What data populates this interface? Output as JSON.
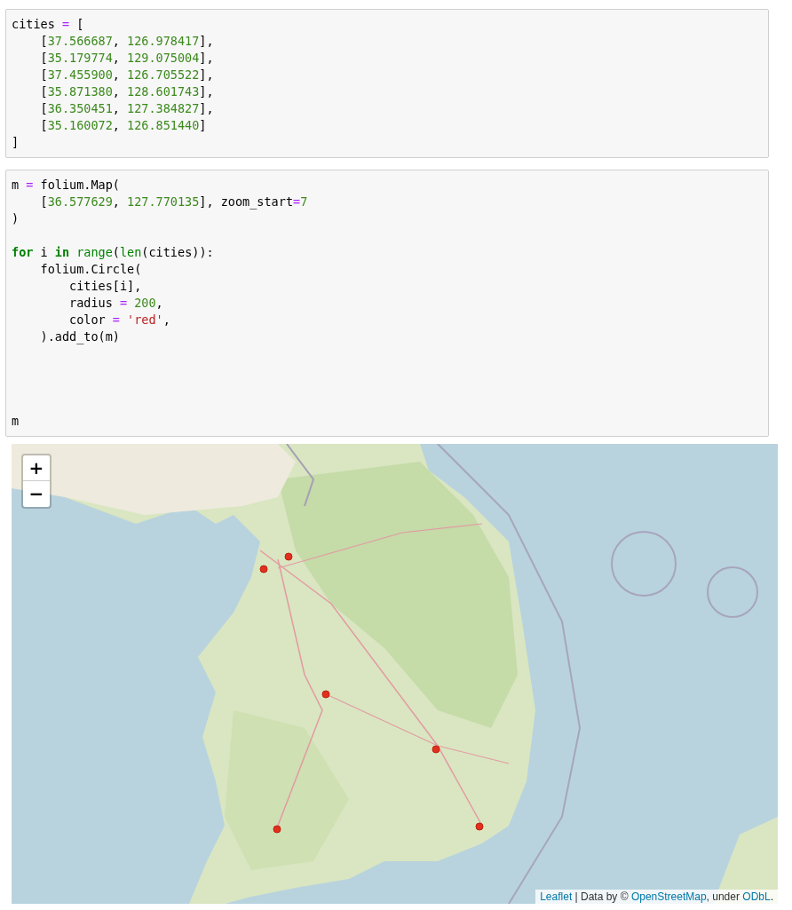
{
  "cells": [
    {
      "lines": [
        {
          "kind": "code",
          "tokens": [
            {
              "t": "cities ",
              "kind": "plain"
            },
            {
              "t": "=",
              "kind": "op"
            },
            {
              "t": " [",
              "kind": "plain"
            }
          ]
        },
        {
          "kind": "code",
          "tokens": [
            {
              "t": "    [",
              "kind": "plain"
            },
            {
              "t": "37.566687",
              "kind": "num"
            },
            {
              "t": ", ",
              "kind": "plain"
            },
            {
              "t": "126.978417",
              "kind": "num"
            },
            {
              "t": "],",
              "kind": "plain"
            }
          ]
        },
        {
          "kind": "code",
          "tokens": [
            {
              "t": "    [",
              "kind": "plain"
            },
            {
              "t": "35.179774",
              "kind": "num"
            },
            {
              "t": ", ",
              "kind": "plain"
            },
            {
              "t": "129.075004",
              "kind": "num"
            },
            {
              "t": "],",
              "kind": "plain"
            }
          ]
        },
        {
          "kind": "code",
          "tokens": [
            {
              "t": "    [",
              "kind": "plain"
            },
            {
              "t": "37.455900",
              "kind": "num"
            },
            {
              "t": ", ",
              "kind": "plain"
            },
            {
              "t": "126.705522",
              "kind": "num"
            },
            {
              "t": "],",
              "kind": "plain"
            }
          ]
        },
        {
          "kind": "code",
          "tokens": [
            {
              "t": "    [",
              "kind": "plain"
            },
            {
              "t": "35.871380",
              "kind": "num"
            },
            {
              "t": ", ",
              "kind": "plain"
            },
            {
              "t": "128.601743",
              "kind": "num"
            },
            {
              "t": "],",
              "kind": "plain"
            }
          ]
        },
        {
          "kind": "code",
          "tokens": [
            {
              "t": "    [",
              "kind": "plain"
            },
            {
              "t": "36.350451",
              "kind": "num"
            },
            {
              "t": ", ",
              "kind": "plain"
            },
            {
              "t": "127.384827",
              "kind": "num"
            },
            {
              "t": "],",
              "kind": "plain"
            }
          ]
        },
        {
          "kind": "code",
          "tokens": [
            {
              "t": "    [",
              "kind": "plain"
            },
            {
              "t": "35.160072",
              "kind": "num"
            },
            {
              "t": ", ",
              "kind": "plain"
            },
            {
              "t": "126.851440",
              "kind": "num"
            },
            {
              "t": "]",
              "kind": "plain"
            }
          ]
        },
        {
          "kind": "code",
          "tokens": [
            {
              "t": "]",
              "kind": "plain"
            }
          ]
        }
      ]
    },
    {
      "lines": [
        {
          "kind": "code",
          "tokens": [
            {
              "t": "m ",
              "kind": "plain"
            },
            {
              "t": "=",
              "kind": "op"
            },
            {
              "t": " folium.Map(",
              "kind": "plain"
            }
          ]
        },
        {
          "kind": "code",
          "tokens": [
            {
              "t": "    [",
              "kind": "plain"
            },
            {
              "t": "36.577629",
              "kind": "num"
            },
            {
              "t": ", ",
              "kind": "plain"
            },
            {
              "t": "127.770135",
              "kind": "num"
            },
            {
              "t": "], zoom_start",
              "kind": "plain"
            },
            {
              "t": "=",
              "kind": "op"
            },
            {
              "t": "7",
              "kind": "num"
            }
          ]
        },
        {
          "kind": "code",
          "tokens": [
            {
              "t": ")",
              "kind": "plain"
            }
          ]
        },
        {
          "kind": "blank"
        },
        {
          "kind": "code",
          "tokens": [
            {
              "t": "for",
              "kind": "kw"
            },
            {
              "t": " i ",
              "kind": "plain"
            },
            {
              "t": "in",
              "kind": "kw"
            },
            {
              "t": " range",
              "kind": "builtin"
            },
            {
              "t": "(",
              "kind": "plain"
            },
            {
              "t": "len",
              "kind": "builtin"
            },
            {
              "t": "(cities)):",
              "kind": "plain"
            }
          ]
        },
        {
          "kind": "code",
          "tokens": [
            {
              "t": "    folium.Circle(",
              "kind": "plain"
            }
          ]
        },
        {
          "kind": "code",
          "tokens": [
            {
              "t": "        cities[i],",
              "kind": "plain"
            }
          ]
        },
        {
          "kind": "code",
          "tokens": [
            {
              "t": "        radius ",
              "kind": "plain"
            },
            {
              "t": "=",
              "kind": "op"
            },
            {
              "t": " 200",
              "kind": "num"
            },
            {
              "t": ",",
              "kind": "plain"
            }
          ]
        },
        {
          "kind": "code",
          "tokens": [
            {
              "t": "        color ",
              "kind": "plain"
            },
            {
              "t": "=",
              "kind": "op"
            },
            {
              "t": " 'red'",
              "kind": "str"
            },
            {
              "t": ",",
              "kind": "plain"
            }
          ]
        },
        {
          "kind": "code",
          "tokens": [
            {
              "t": "    ).add_to(m)",
              "kind": "plain"
            }
          ]
        },
        {
          "kind": "blank"
        },
        {
          "kind": "blank"
        },
        {
          "kind": "blank"
        },
        {
          "kind": "blank"
        },
        {
          "kind": "code",
          "tokens": [
            {
              "t": "m",
              "kind": "plain"
            }
          ]
        }
      ]
    }
  ],
  "map": {
    "kind": "picture",
    "zoom_in": "+",
    "zoom_out": "−",
    "attribution": [
      {
        "t": "Leaflet",
        "link": true
      },
      {
        "t": " | Data by © ",
        "link": false
      },
      {
        "t": "OpenStreetMap",
        "link": true
      },
      {
        "t": ", under ",
        "link": false
      },
      {
        "t": "ODbL",
        "link": true
      },
      {
        "t": ".",
        "link": false
      }
    ]
  }
}
